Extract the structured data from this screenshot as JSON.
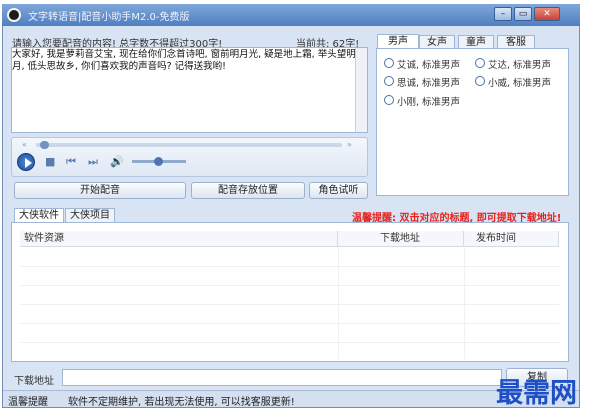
{
  "window": {
    "title": "文字转语音|配音小助手M2.0-免费版"
  },
  "editor": {
    "prompt": "请输入您要配音的内容! 总字数不得超过300字!",
    "char_count": "当前共: 62字!",
    "content": "大家好, 我是萝莉音艾宝, 现在给你们念首诗吧, 窗前明月光, 疑是地上霜, 举头望明月, 低头思故乡, 你们喜欢我的声音吗? 记得送我哟!"
  },
  "voice_tabs": [
    "男声",
    "女声",
    "童声",
    "客服"
  ],
  "voices": [
    {
      "label": "艾诚, 标准男声",
      "selected": false
    },
    {
      "label": "艾达, 标准男声",
      "selected": false
    },
    {
      "label": "思诚, 标准男声",
      "selected": false
    },
    {
      "label": "小威, 标准男声",
      "selected": false
    },
    {
      "label": "小刚, 标准男声",
      "selected": false
    }
  ],
  "buttons": {
    "start": "开始配音",
    "save_location": "配音存放位置",
    "role_trial": "角色试听"
  },
  "notice": "温馨提醒: 双击对应的标题, 即可提取下载地址!",
  "lower_tabs": [
    "大侠软件",
    "大侠项目"
  ],
  "table": {
    "columns": [
      "软件资源",
      "下载地址",
      "发布时间"
    ],
    "rows": []
  },
  "download": {
    "label": "下载地址",
    "value": "",
    "button": "复制"
  },
  "status": {
    "label": "温馨提醒",
    "message": "软件不定期维护, 若出现无法使用, 可以找客服更新!"
  },
  "watermark": "最需网",
  "colors": {
    "accent": "#1e4fc7",
    "notice": "#e8231e",
    "frame": "#d8e4f3"
  }
}
